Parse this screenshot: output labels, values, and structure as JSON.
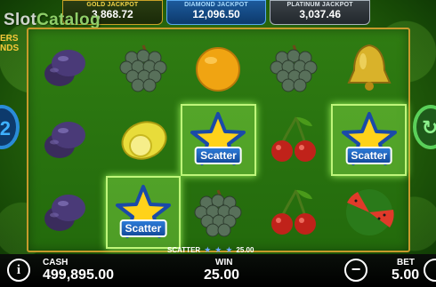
{
  "watermark": {
    "brand": "Slot",
    "tag": "Catalog"
  },
  "side_logo": {
    "line1": "ERS",
    "line2": "NDS"
  },
  "jackpots": [
    {
      "title": "GOLD JACKPOT",
      "value": "3,868.72"
    },
    {
      "title": "DIAMOND JACKPOT",
      "value": "12,096.50"
    },
    {
      "title": "PLATINUM JACKPOT",
      "value": "3,037.46"
    }
  ],
  "reels": [
    [
      "plum",
      "grapes",
      "orange",
      "grapes",
      "bell"
    ],
    [
      "plum",
      "lemon",
      "scatter",
      "cherries",
      "scatter"
    ],
    [
      "plum",
      "scatter",
      "grapes",
      "cherries",
      "watermelon"
    ]
  ],
  "scatter_text": "Scatter",
  "win_line": {
    "symbol": "SCATTER",
    "amount": "25.00"
  },
  "side_buttons": {
    "left": "2",
    "right": "↻"
  },
  "bottom_bar": {
    "info": "i",
    "cash_label": "CASH",
    "cash_value": "499,895.00",
    "win_label": "WIN",
    "win_value": "25.00",
    "minus": "−",
    "bet_label": "BET",
    "bet_value": "5.00"
  },
  "colors": {
    "frame": "#c79a2c",
    "win_highlight": "#bff57a",
    "scatter_badge": "#2c7ad8"
  }
}
